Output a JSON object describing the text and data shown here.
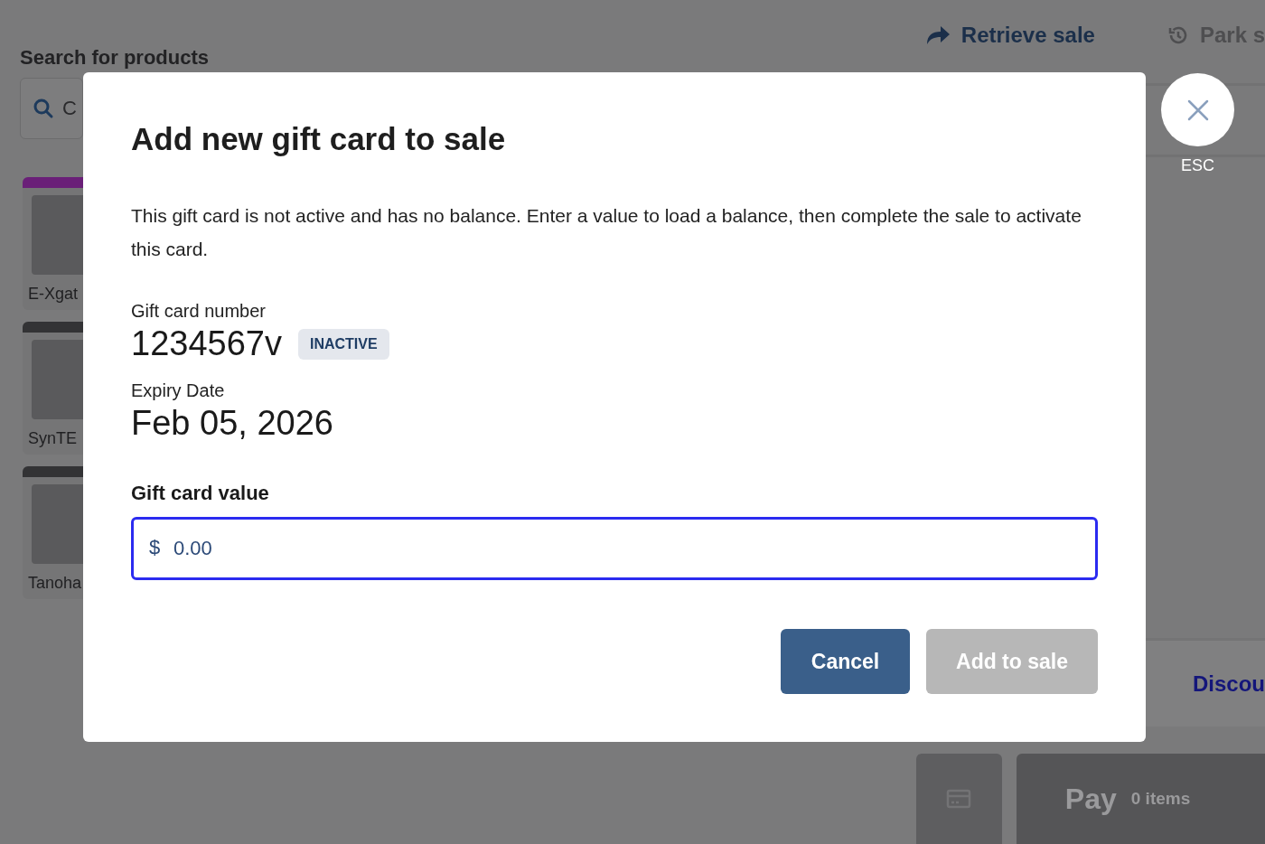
{
  "background": {
    "search": {
      "label": "Search for products",
      "placeholder": "C"
    },
    "products": [
      {
        "name": "E-Xgat",
        "color": "#6a1f78"
      },
      {
        "name": "SynTE",
        "color": "#333335"
      },
      {
        "name": "Tanoha",
        "color": "#333335"
      }
    ],
    "toolbar": [
      {
        "label": "Retrieve sale",
        "disabled": false
      },
      {
        "label": "Park s",
        "disabled": true
      }
    ],
    "discount_link": "Discou",
    "pay": {
      "label": "Pay",
      "count": "0 items",
      "disabled": true
    }
  },
  "modal": {
    "title": "Add new gift card to sale",
    "message": "This gift card is not active and has no balance. Enter a value to load a balance, then complete the sale to activate this card.",
    "fields": [
      {
        "label": "Gift card number",
        "value": "1234567v",
        "badge": "INACTIVE"
      },
      {
        "label": "Expiry Date",
        "value": "Feb 05, 2026"
      }
    ],
    "input": {
      "label": "Gift card value",
      "prefix": "$",
      "placeholder": "0.00",
      "focused": true
    },
    "buttons": [
      {
        "label": "Cancel",
        "disabled": false
      },
      {
        "label": "Add to sale",
        "disabled": true
      }
    ],
    "close": {
      "key": "ESC"
    }
  }
}
